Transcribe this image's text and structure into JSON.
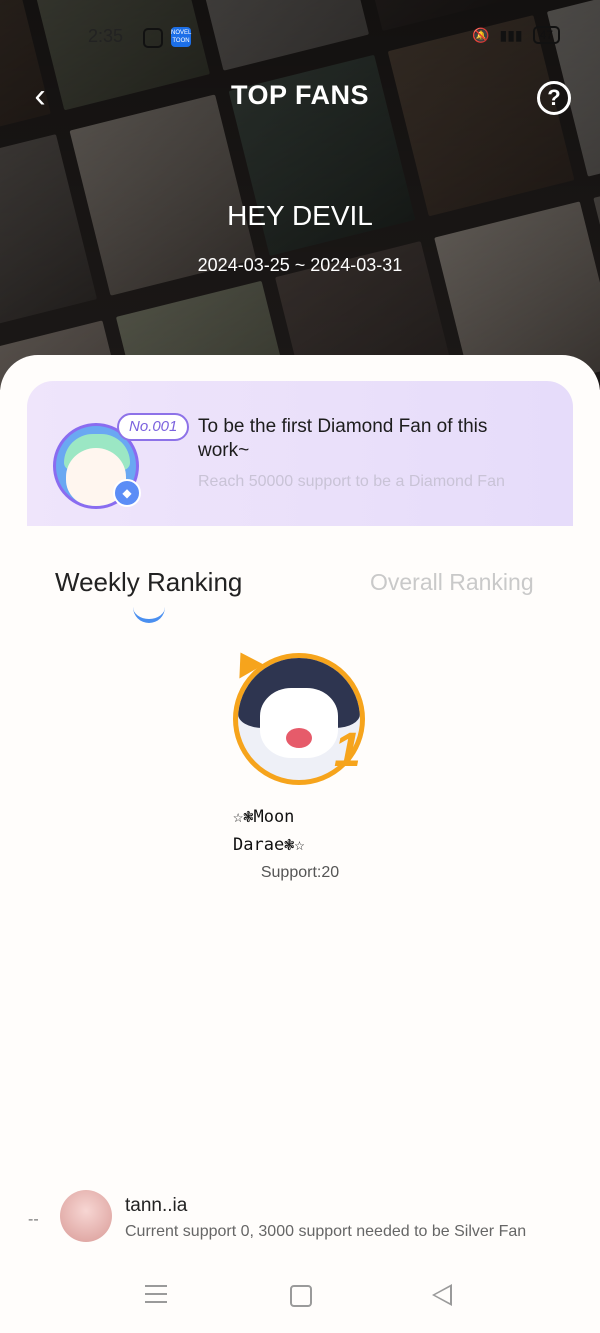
{
  "statusbar": {
    "time": "2:35",
    "app_icon": "NOVEL TOON",
    "battery": "47"
  },
  "header": {
    "title": "TOP FANS",
    "back_icon": "chevron-left-icon",
    "help_icon": "question-circle-icon",
    "help_symbol": "?"
  },
  "work": {
    "title": "HEY DEVIL",
    "date_range": "2024-03-25 ~ 2024-03-31"
  },
  "diamond_card": {
    "badge": "No.001",
    "headline": "To be the first Diamond Fan of this work~",
    "subtext": "Reach 50000 support to be a Diamond Fan"
  },
  "tabs": {
    "weekly": "Weekly Ranking",
    "overall": "Overall Ranking",
    "active": "weekly"
  },
  "top_fan": {
    "rank": "1",
    "name_line1": "☆❃Moon",
    "name_line2": "Darae❃☆",
    "support": "Support:20"
  },
  "my_rank": {
    "position": "--",
    "name": "tann..ia",
    "note": "Current support 0, 3000 support needed to be Silver Fan"
  },
  "colors": {
    "accent": "#4a8ff0",
    "gold": "#f6a41c",
    "diamond_purple": "#8d72e8"
  }
}
